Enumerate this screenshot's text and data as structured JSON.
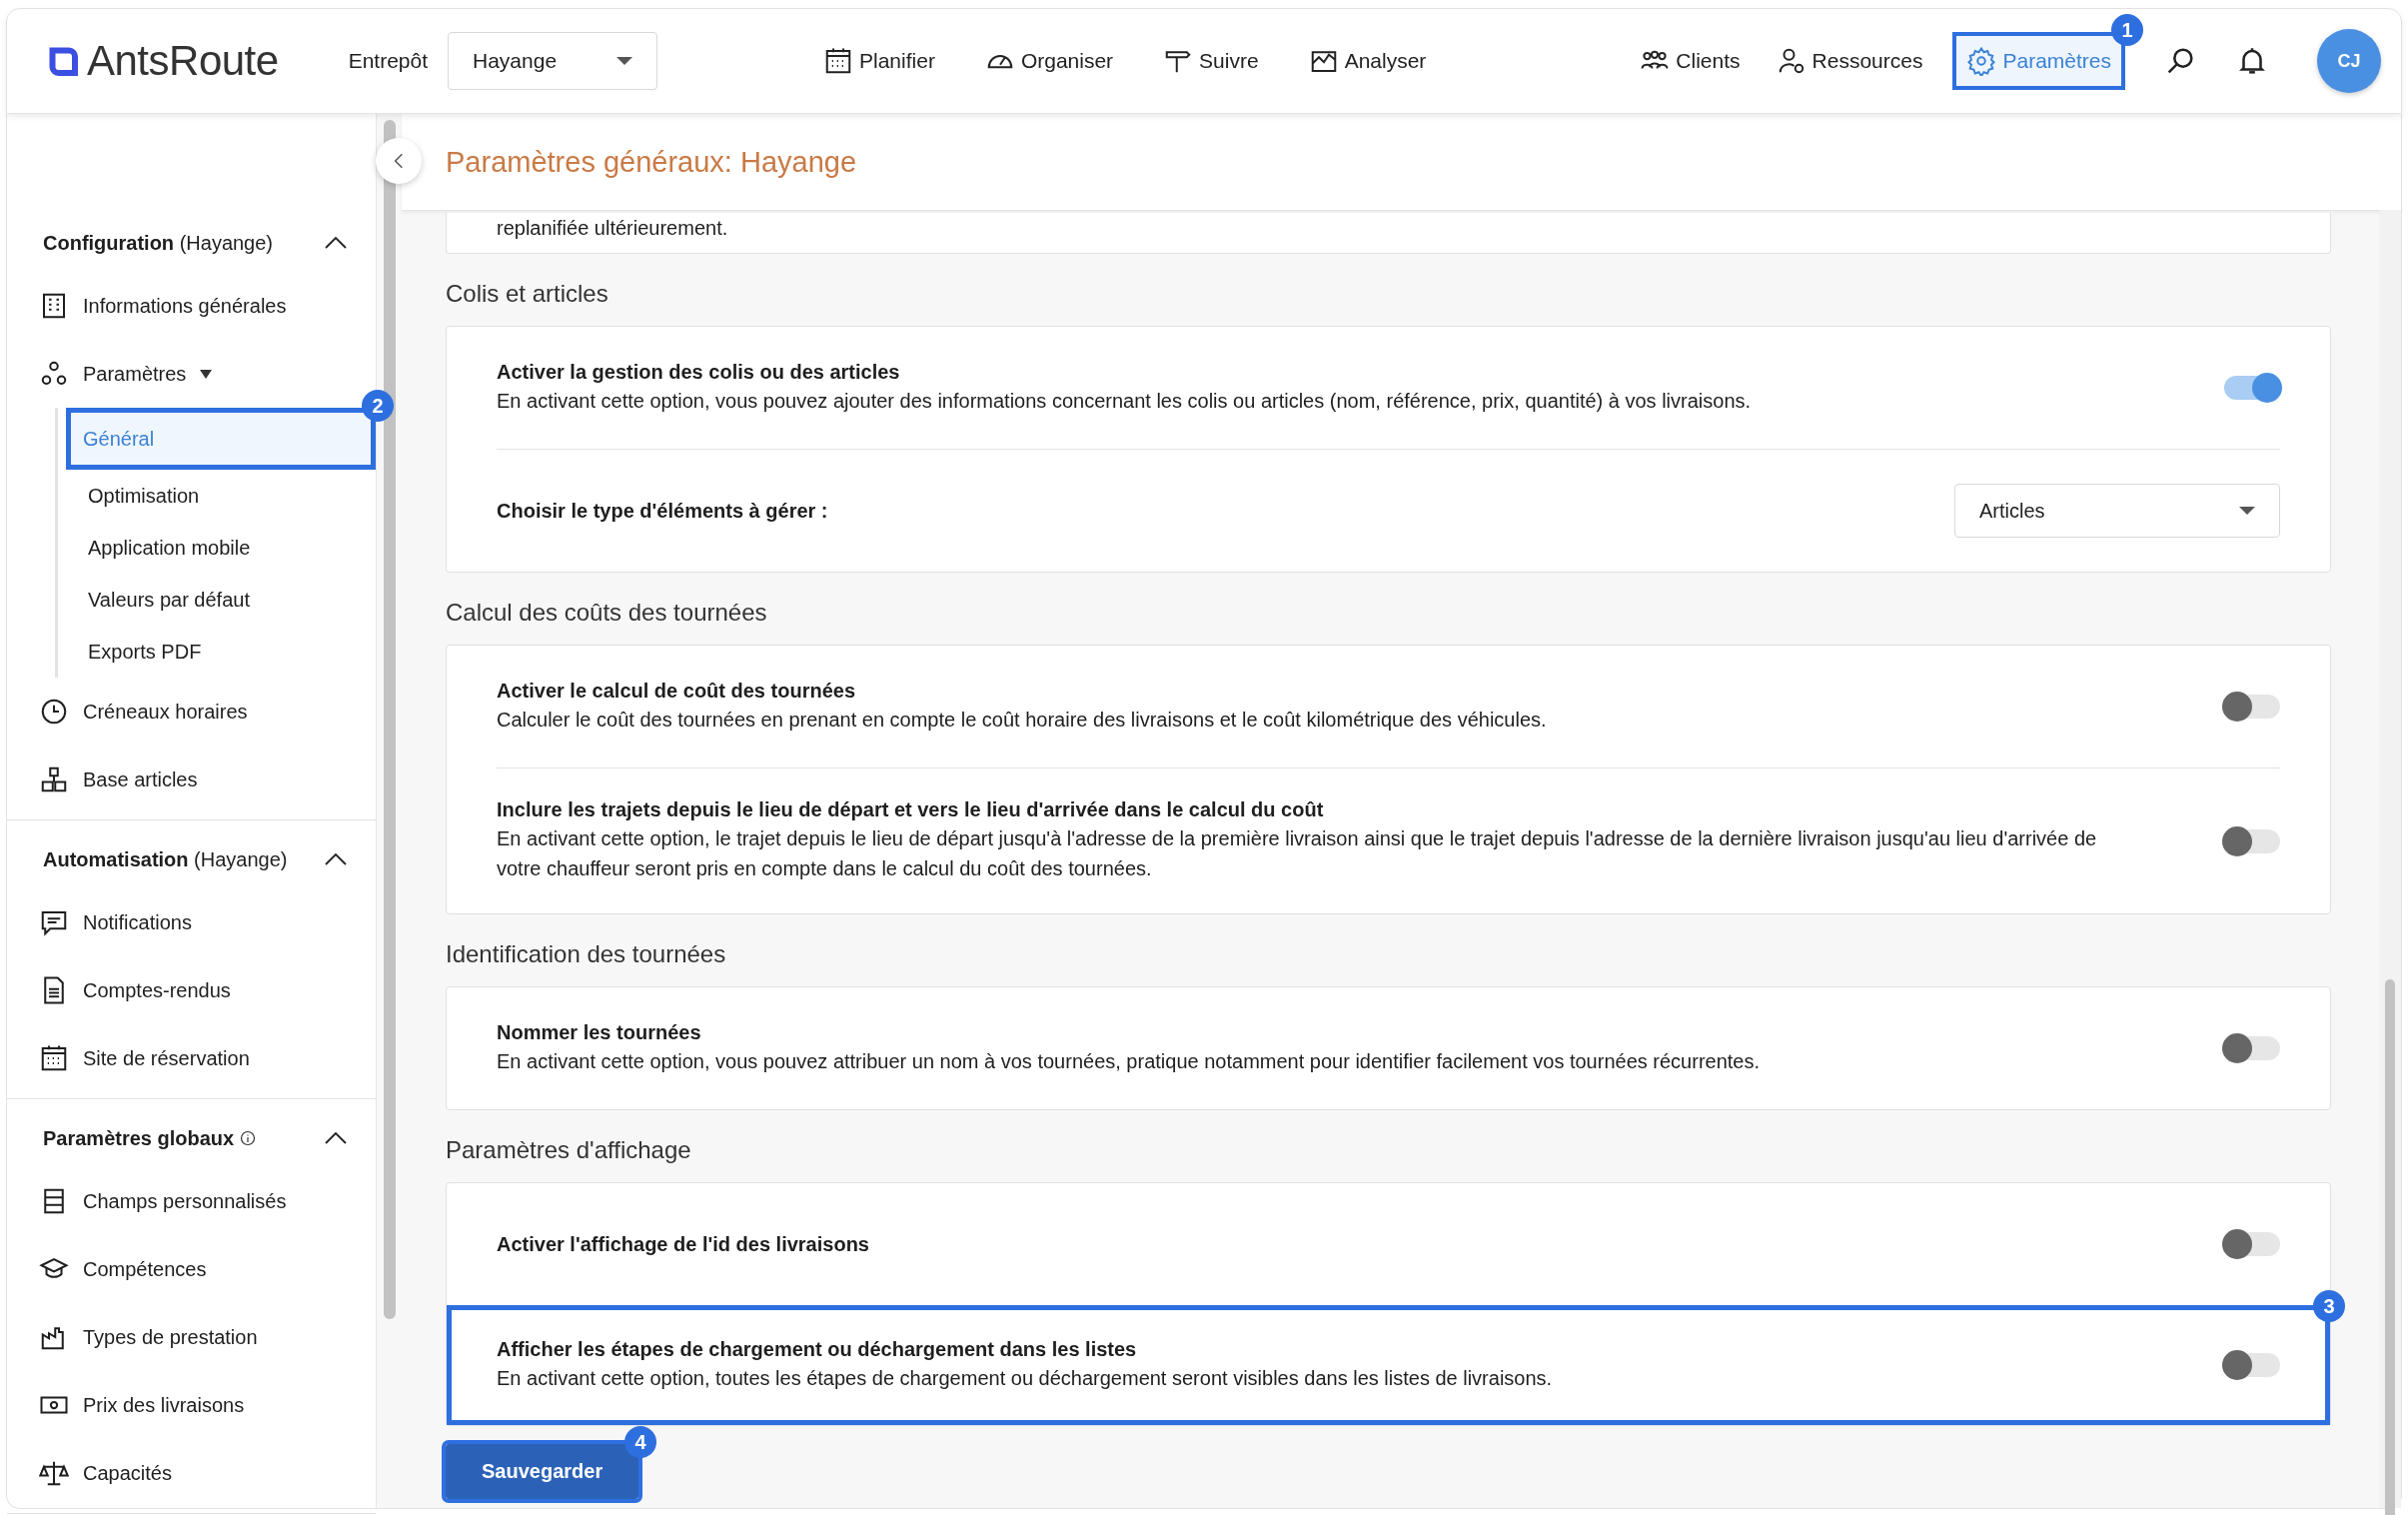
{
  "brand": {
    "name": "**Ants**Route"
  },
  "warehouse": {
    "label": "Entrepôt",
    "value": "Hayange"
  },
  "nav": [
    {
      "label": "Planifier",
      "kind": "calendar"
    },
    {
      "label": "Organiser",
      "kind": "gauge"
    },
    {
      "label": "Suivre",
      "kind": "signpost"
    },
    {
      "label": "Analyser",
      "kind": "chart"
    }
  ],
  "nav_right": [
    {
      "label": "Clients",
      "kind": "people",
      "selected": false
    },
    {
      "label": "Ressources",
      "kind": "person-gear",
      "selected": false
    },
    {
      "label": "Paramètres",
      "kind": "gear",
      "selected": true,
      "callout": "1"
    }
  ],
  "avatar": "CJ",
  "sidebar": {
    "sections": [
      {
        "title": "**Configuration** (Hayange)",
        "expanded": true,
        "items": [
          {
            "label": "Informations générales",
            "kind": "building"
          },
          {
            "label": "Paramètres",
            "kind": "gears",
            "expanded": true,
            "children": [
              {
                "label": "Général",
                "selected": true,
                "callout": "2"
              },
              {
                "label": "Optimisation",
                "selected": false
              },
              {
                "label": "Application mobile",
                "selected": false
              },
              {
                "label": "Valeurs par défaut",
                "selected": false
              },
              {
                "label": "Exports PDF",
                "selected": false
              }
            ]
          },
          {
            "label": "Créneaux horaires",
            "kind": "clock"
          },
          {
            "label": "Base articles",
            "kind": "boxes"
          }
        ]
      },
      {
        "title": "**Automatisation** (Hayange)",
        "expanded": true,
        "items": [
          {
            "label": "Notifications",
            "kind": "message"
          },
          {
            "label": "Comptes-rendus",
            "kind": "document"
          },
          {
            "label": "Site de réservation",
            "kind": "calendar"
          }
        ]
      },
      {
        "title": "**Paramètres globaux**",
        "info": true,
        "expanded": true,
        "items": [
          {
            "label": "Champs personnalisés",
            "kind": "rows"
          },
          {
            "label": "Compétences",
            "kind": "cap"
          },
          {
            "label": "Types de prestation",
            "kind": "factory"
          },
          {
            "label": "Prix des livraisons",
            "kind": "banknote"
          },
          {
            "label": "Capacités",
            "kind": "scale"
          }
        ]
      }
    ]
  },
  "page_title": "Paramètres généraux: Hayange",
  "cut_text": "replanifiée ultérieurement.",
  "groups": [
    {
      "title": "Colis et articles",
      "settings": [
        {
          "kind": "toggle",
          "title": "Activer la gestion des colis ou des articles",
          "description": "En activant cette option, vous pouvez ajouter des informations concernant les colis ou articles (nom, référence, prix, quantité) à vos livraisons.",
          "on": true
        },
        {
          "kind": "select",
          "title": "Choisir le type d'éléments à gérer :",
          "value": "Articles"
        }
      ]
    },
    {
      "title": "Calcul des coûts des tournées",
      "settings": [
        {
          "kind": "toggle",
          "title": "Activer le calcul de coût des tournées",
          "description": "Calculer le coût des tournées en prenant en compte le coût horaire des livraisons et le coût kilométrique des véhicules.",
          "on": false
        },
        {
          "kind": "toggle",
          "title": "Inclure les trajets depuis le lieu de départ et vers le lieu d'arrivée dans le calcul du coût",
          "description": "En activant cette option, le trajet depuis le lieu de départ jusqu'à l'adresse de la première livraison ainsi que le trajet depuis l'adresse de la dernière livraison jusqu'au lieu d'arrivée de votre chauffeur seront pris en compte dans le calcul du coût des tournées.",
          "on": false
        }
      ]
    },
    {
      "title": "Identification des tournées",
      "settings": [
        {
          "kind": "toggle",
          "title": "Nommer les tournées",
          "description": "En activant cette option, vous pouvez attribuer un nom à vos tournées, pratique notamment pour identifier facilement vos tournées récurrentes.",
          "on": false
        }
      ]
    },
    {
      "title": "Paramètres d'affichage",
      "settings": [
        {
          "kind": "toggle",
          "title": "Activer l'affichage de l'id des livraisons",
          "on": false
        },
        {
          "kind": "toggle",
          "title": "Afficher les étapes de chargement ou déchargement dans les listes",
          "description": "En activant cette option, toutes les étapes de chargement ou déchargement seront visibles dans les listes de livraisons.",
          "on": false,
          "callout": "3"
        }
      ]
    }
  ],
  "save": {
    "label": "Sauvegarder",
    "callout": "4"
  }
}
